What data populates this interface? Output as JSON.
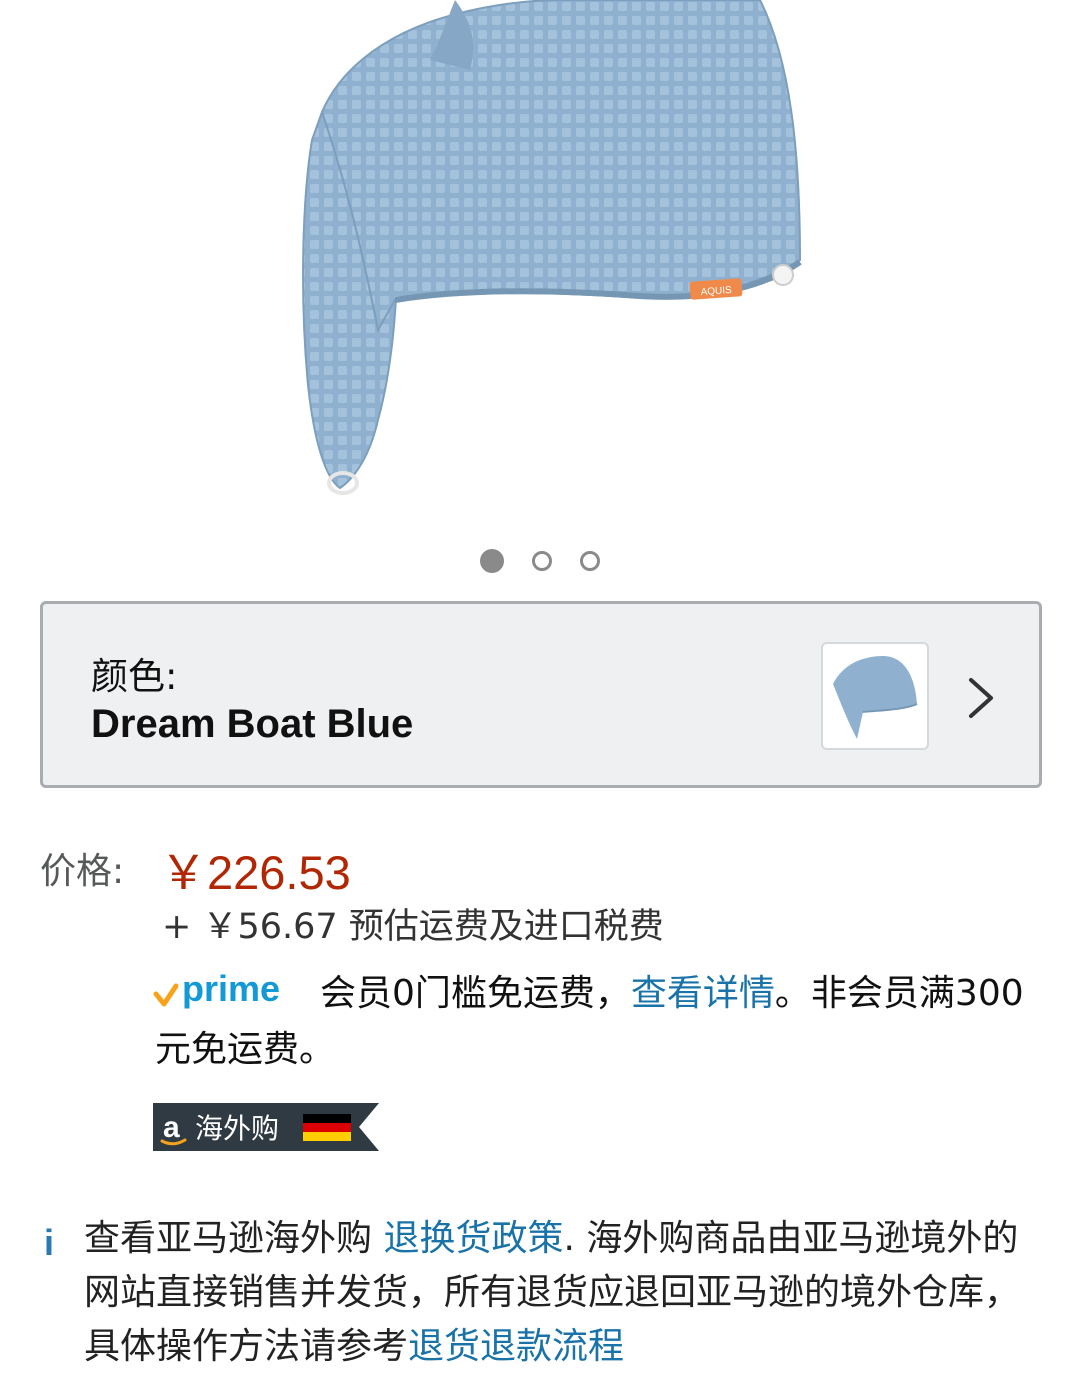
{
  "product": {
    "carousel": {
      "count": 3,
      "active_index": 0
    },
    "tag_text": "AQUIS"
  },
  "color": {
    "label": "颜色:",
    "value": "Dream Boat Blue",
    "swatch_color": "#8fb1cf"
  },
  "price": {
    "label": "价格:",
    "value": "￥226.53",
    "shipping": "+ ￥56.67 预估运费及进口税费"
  },
  "prime": {
    "logo_text": "prime",
    "text_before": "会员0门槛免运费，",
    "link_text": "查看详情",
    "text_after": "。非会员满300元免运费。"
  },
  "badge": {
    "label": "海外购",
    "logo_letter": "a"
  },
  "info": {
    "icon_glyph": "i",
    "text_before": "查看亚马逊海外购 ",
    "link1": "退换货政策",
    "text_middle": ". 海外购商品由亚马逊境外的网站直接销售并发货，所有退货应退回亚马逊的境外仓库，具体操作方法请参考",
    "link2": "退货退款流程"
  },
  "colors": {
    "price_red": "#b12704",
    "link_blue": "#1a73a8",
    "prime_blue": "#1399d6",
    "prime_orange": "#f7a21b",
    "towel_blue": "#8fb1cf"
  }
}
